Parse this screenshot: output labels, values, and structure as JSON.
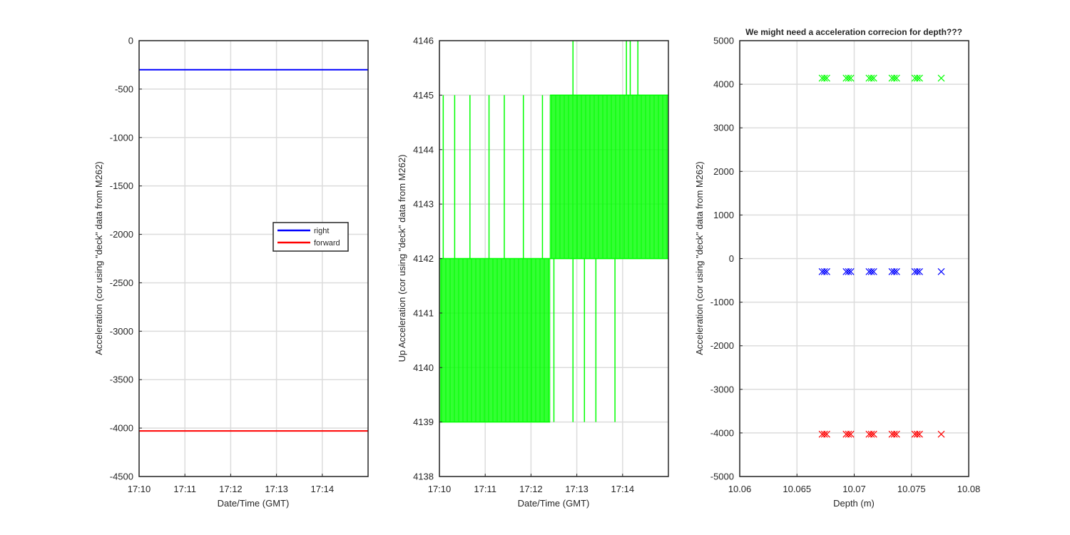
{
  "chart_data": [
    {
      "type": "line",
      "title": "",
      "xlabel": "Date/Time (GMT)",
      "ylabel": "Acceleration (cor using \"deck\" data from M262)",
      "x_ticks": [
        "17:10",
        "17:11",
        "17:12",
        "17:13",
        "17:14"
      ],
      "xlim": [
        "17:10",
        "17:15"
      ],
      "ylim": [
        -4500,
        0
      ],
      "y_ticks": [
        0,
        -500,
        -1000,
        -1500,
        -2000,
        -2500,
        -3000,
        -3500,
        -4000,
        -4500
      ],
      "grid": true,
      "legend": "center-right",
      "series": [
        {
          "name": "right",
          "color": "#0000ff",
          "x": [
            "17:10",
            "17:15"
          ],
          "values": [
            -300,
            -300
          ]
        },
        {
          "name": "forward",
          "color": "#ff0000",
          "x": [
            "17:10",
            "17:15"
          ],
          "values": [
            -4030,
            -4030
          ]
        }
      ]
    },
    {
      "type": "line",
      "title": "",
      "xlabel": "Date/Time (GMT)",
      "ylabel": "Up Acceleration (cor using \"deck\" data from M262)",
      "x_ticks": [
        "17:10",
        "17:11",
        "17:12",
        "17:13",
        "17:14"
      ],
      "xlim": [
        "17:10",
        "17:15"
      ],
      "ylim": [
        4138,
        4146
      ],
      "y_ticks": [
        4146,
        4145,
        4144,
        4143,
        4142,
        4141,
        4140,
        4139,
        4138
      ],
      "grid": true,
      "series": [
        {
          "color": "#00ff00",
          "x": [
            "17:10",
            "17:12:25",
            "17:12:25",
            "17:15"
          ],
          "band_low": [
            4139,
            4139,
            4142,
            4142
          ],
          "band_high": [
            4142,
            4142,
            4145,
            4145
          ],
          "spikes_high": [
            [
              "17:10:05",
              4145
            ],
            [
              "17:10:20",
              4145
            ],
            [
              "17:10:40",
              4145
            ],
            [
              "17:11:05",
              4145
            ],
            [
              "17:11:25",
              4145
            ],
            [
              "17:11:50",
              4145
            ],
            [
              "17:12:15",
              4145
            ],
            [
              "17:12:55",
              4146
            ],
            [
              "17:14:05",
              4146
            ],
            [
              "17:14:10",
              4146
            ],
            [
              "17:14:20",
              4146
            ]
          ],
          "spikes_low": [
            [
              "17:12:30",
              4139
            ],
            [
              "17:12:55",
              4139
            ],
            [
              "17:13:10",
              4139
            ],
            [
              "17:13:25",
              4139
            ],
            [
              "17:13:50",
              4139
            ]
          ]
        }
      ]
    },
    {
      "type": "scatter",
      "title": "We might need a acceleration correcion for depth???",
      "xlabel": "Depth (m)",
      "ylabel": "Acceleration (cor using \"deck\" data from M262)",
      "xlim": [
        10.06,
        10.08
      ],
      "ylim": [
        -5000,
        5000
      ],
      "x_ticks": [
        "10.06",
        "10.065",
        "10.07",
        "10.075",
        "10.08"
      ],
      "y_ticks": [
        5000,
        4000,
        3000,
        2000,
        1000,
        0,
        -1000,
        -2000,
        -3000,
        -4000,
        -5000
      ],
      "grid": true,
      "marker": "x",
      "x": [
        10.0672,
        10.0674,
        10.0676,
        10.0693,
        10.0695,
        10.0697,
        10.0713,
        10.0715,
        10.0717,
        10.0733,
        10.0735,
        10.0737,
        10.0753,
        10.0755,
        10.0757,
        10.0776
      ],
      "series": [
        {
          "color": "#00ff00",
          "values": [
            4140,
            4140,
            4140,
            4140,
            4140,
            4140,
            4140,
            4140,
            4140,
            4140,
            4140,
            4140,
            4140,
            4140,
            4140,
            4140
          ]
        },
        {
          "color": "#0000ff",
          "values": [
            -300,
            -300,
            -300,
            -300,
            -300,
            -300,
            -300,
            -300,
            -300,
            -300,
            -300,
            -300,
            -300,
            -300,
            -300,
            -300
          ]
        },
        {
          "color": "#ff0000",
          "values": [
            -4030,
            -4030,
            -4030,
            -4030,
            -4030,
            -4030,
            -4030,
            -4030,
            -4030,
            -4030,
            -4030,
            -4030,
            -4030,
            -4030,
            -4030,
            -4030
          ]
        }
      ]
    }
  ]
}
